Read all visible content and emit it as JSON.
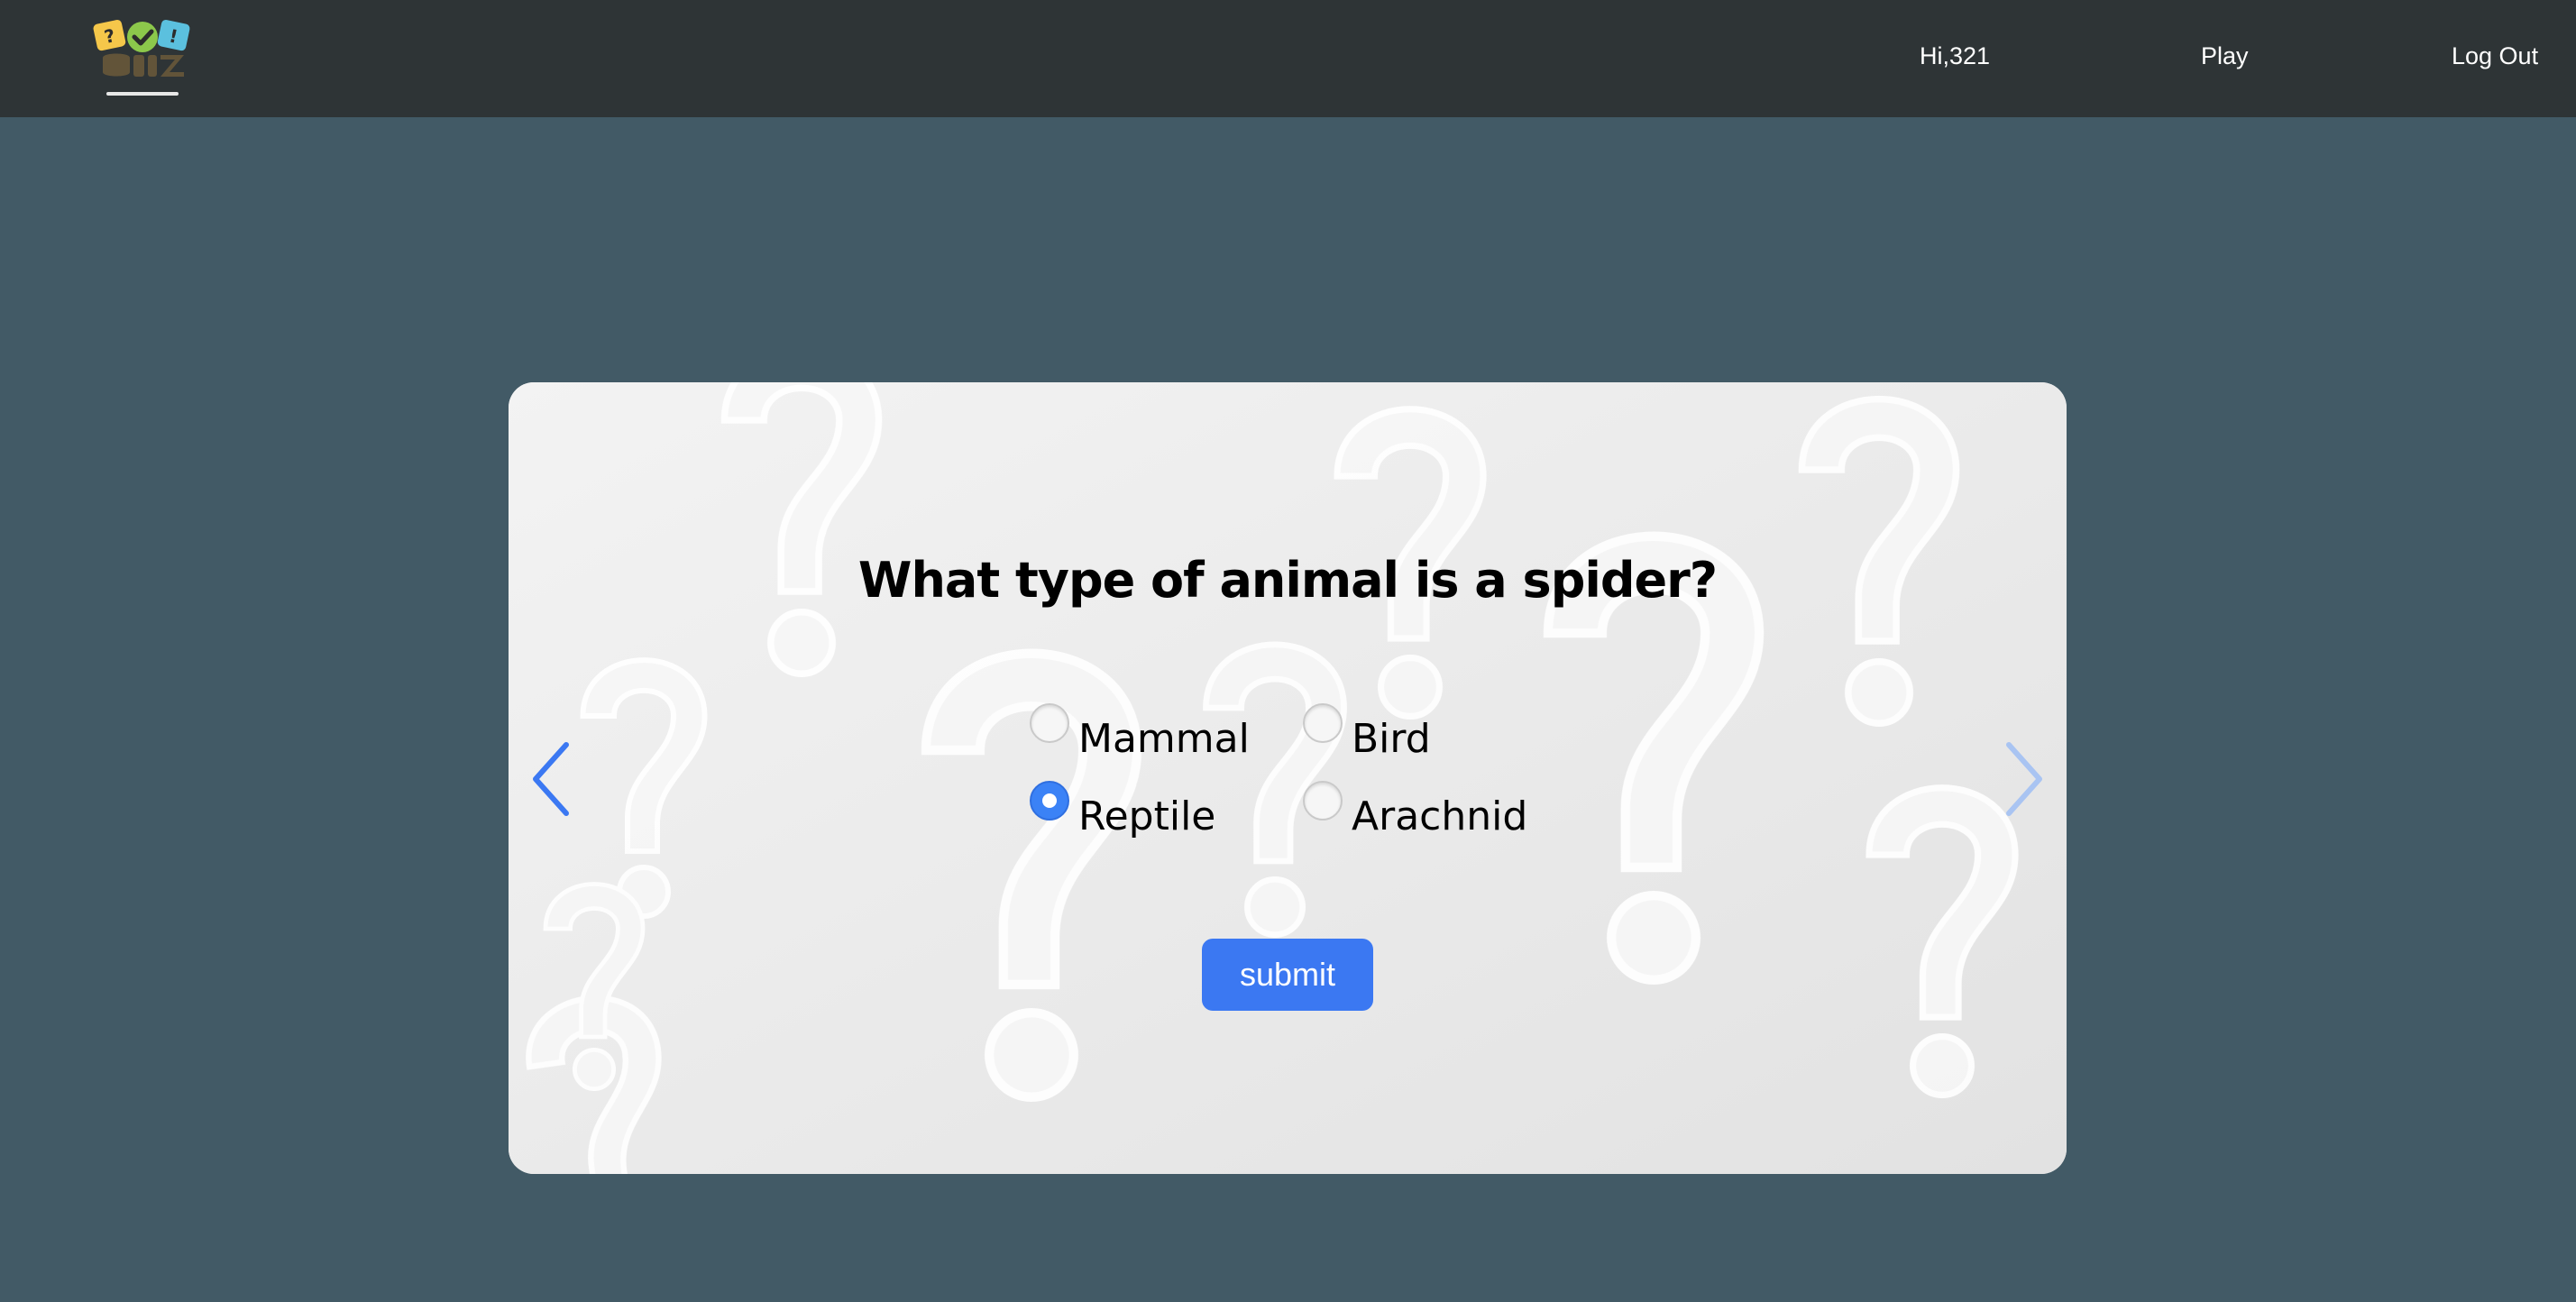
{
  "navbar": {
    "logo_icon": "quiz-logo",
    "greeting": "Hi,321",
    "play_label": "Play",
    "logout_label": "Log Out",
    "background": "#2e3436"
  },
  "quiz": {
    "question": "What type of animal is a spider?",
    "options": [
      {
        "label": "Mammal",
        "selected": false
      },
      {
        "label": "Bird",
        "selected": false
      },
      {
        "label": "Reptile",
        "selected": true
      },
      {
        "label": "Arachnid",
        "selected": false
      }
    ],
    "submit_label": "submit",
    "prev_icon": "chevron-left-icon",
    "next_icon": "chevron-right-icon",
    "accent_color": "#3b78f2",
    "background_pattern": "question-marks"
  },
  "page": {
    "background": "#425a66"
  }
}
